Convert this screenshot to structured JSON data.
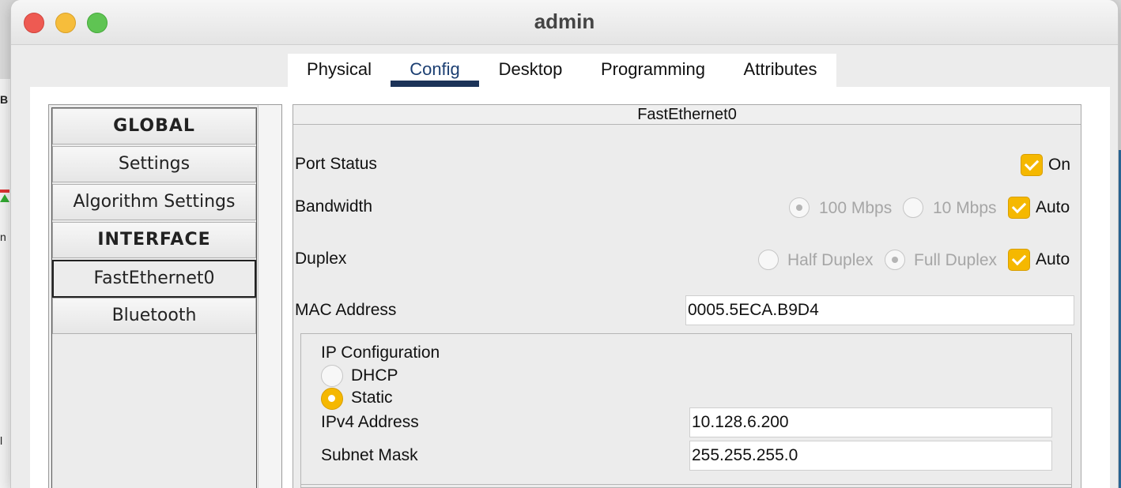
{
  "window": {
    "title": "admin"
  },
  "tabs": [
    {
      "label": "Physical"
    },
    {
      "label": "Config"
    },
    {
      "label": "Desktop"
    },
    {
      "label": "Programming"
    },
    {
      "label": "Attributes"
    }
  ],
  "active_tab": "Config",
  "sidebar": {
    "items": [
      {
        "label": "GLOBAL",
        "kind": "header"
      },
      {
        "label": "Settings"
      },
      {
        "label": "Algorithm Settings"
      },
      {
        "label": "INTERFACE",
        "kind": "header"
      },
      {
        "label": "FastEthernet0",
        "selected": true
      },
      {
        "label": "Bluetooth"
      }
    ]
  },
  "interface": {
    "name": "FastEthernet0",
    "port_status": {
      "label": "Port Status",
      "on_label": "On",
      "checked": true
    },
    "bandwidth": {
      "label": "Bandwidth",
      "option_100": "100 Mbps",
      "option_10": "10 Mbps",
      "auto_label": "Auto",
      "auto_checked": true
    },
    "duplex": {
      "label": "Duplex",
      "option_half": "Half Duplex",
      "option_full": "Full Duplex",
      "auto_label": "Auto",
      "auto_checked": true
    },
    "mac": {
      "label": "MAC Address",
      "value": "0005.5ECA.B9D4"
    },
    "ip_config": {
      "title": "IP Configuration",
      "dhcp_label": "DHCP",
      "static_label": "Static",
      "selected": "Static",
      "ipv4_label": "IPv4 Address",
      "ipv4_value": "10.128.6.200",
      "subnet_label": "Subnet Mask",
      "subnet_value": "255.255.255.0"
    }
  },
  "colors": {
    "accent": "#f5b800",
    "tab_indicator": "#1c3358"
  }
}
